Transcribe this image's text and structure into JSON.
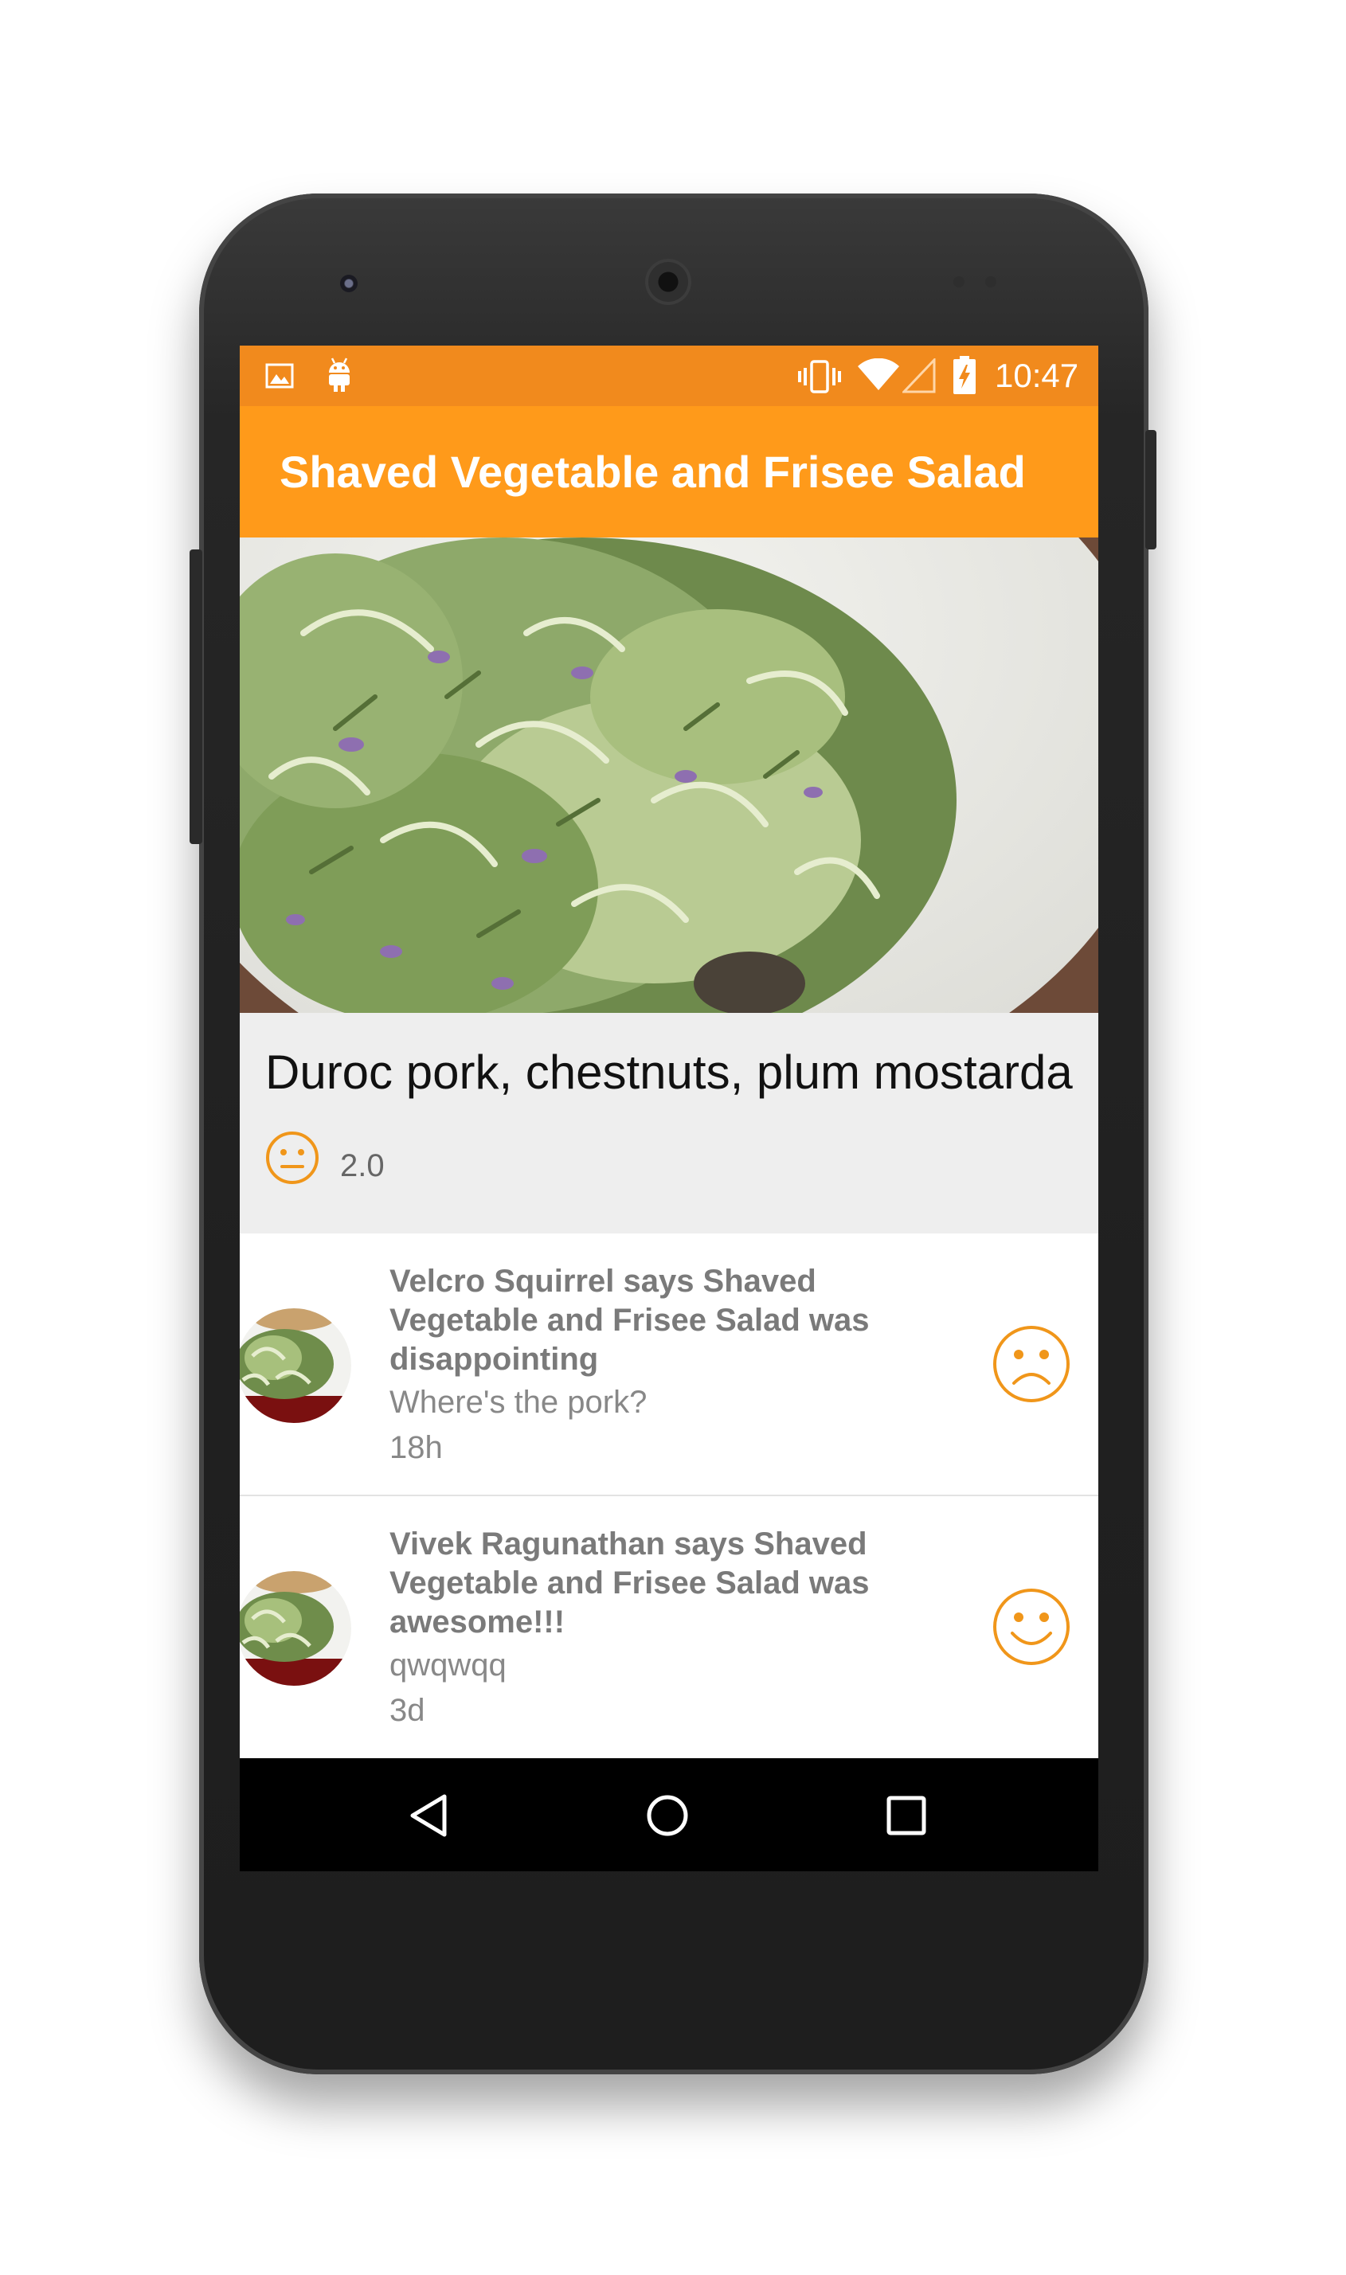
{
  "status_bar": {
    "time": "10:47",
    "left_icons": [
      "image-icon",
      "android-icon"
    ],
    "right_icons": [
      "vibrate-icon",
      "wifi-icon",
      "signal-icon",
      "battery-icon"
    ]
  },
  "app_bar": {
    "title": "Shaved Vegetable and Frisee Salad"
  },
  "dish": {
    "name": "Duroc pork, chestnuts, plum mostarda",
    "rating": "2.0",
    "rating_icon": "neutral-face-icon"
  },
  "reviews": [
    {
      "title": "Velcro Squirrel says Shaved Vegetable and Frisee Salad was disappointing",
      "text": "Where's the pork?",
      "time": "18h",
      "mood_icon": "sad-face-icon"
    },
    {
      "title": "Vivek Ragunathan says Shaved Vegetable and Frisee Salad was awesome!!!",
      "text": "qwqwqq",
      "time": "3d",
      "mood_icon": "happy-face-icon"
    }
  ],
  "nav_bar": {
    "icons": [
      "back-icon",
      "home-icon",
      "recents-icon"
    ]
  },
  "colors": {
    "status_bar": "#f18a1d",
    "app_bar": "#ff9a1a",
    "accent": "#f0961a"
  }
}
